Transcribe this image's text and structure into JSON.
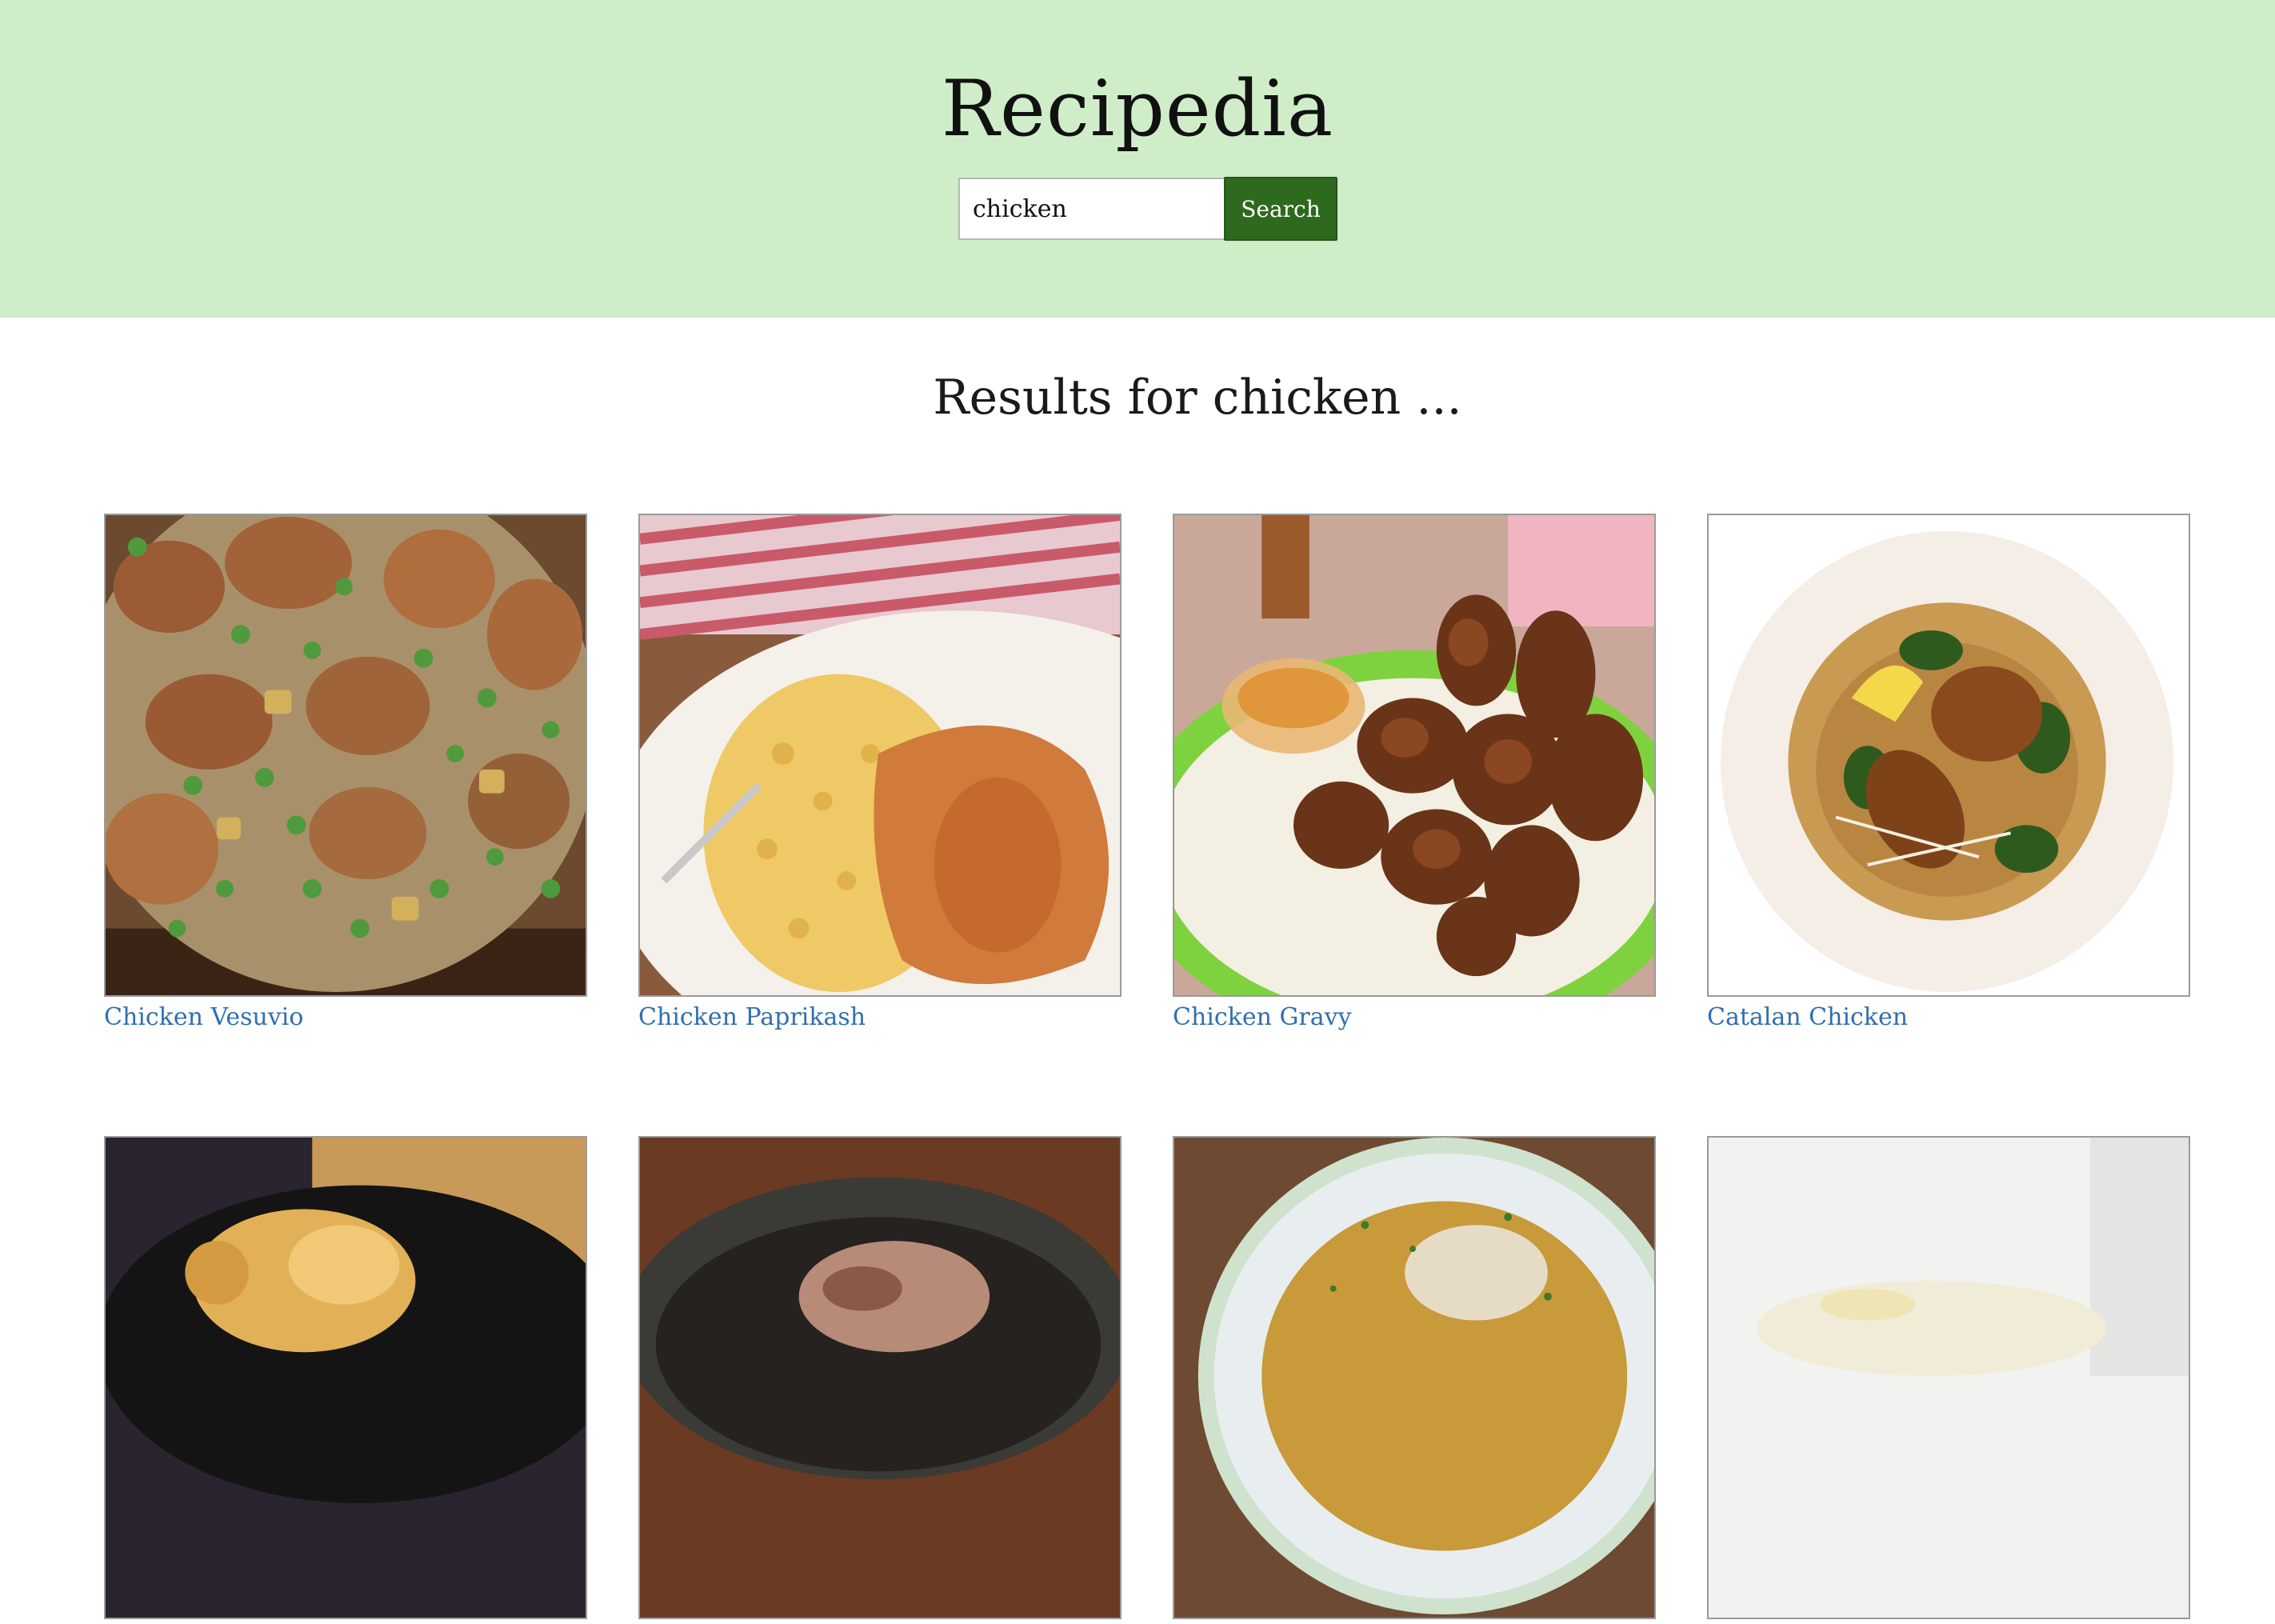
{
  "header": {
    "title": "Recipedia",
    "background_color": "#cfedc9"
  },
  "search": {
    "value": "chicken",
    "button_label": "Search",
    "button_color": "#2d6a1e"
  },
  "results": {
    "heading": "Results for chicken ...",
    "link_color": "#2f6fb0",
    "items": [
      {
        "title": "Chicken Vesuvio",
        "image": "chicken-vesuvio-photo"
      },
      {
        "title": "Chicken Paprikash",
        "image": "chicken-paprikash-photo"
      },
      {
        "title": "Chicken Gravy",
        "image": "fried-chicken-photo"
      },
      {
        "title": "Catalan Chicken",
        "image": "catalan-chicken-photo"
      },
      {
        "title": "",
        "image": "roast-chicken-photo"
      },
      {
        "title": "",
        "image": "braised-dish-photo"
      },
      {
        "title": "",
        "image": "soup-bowl-photo"
      },
      {
        "title": "",
        "image": "light-dish-photo"
      }
    ]
  }
}
